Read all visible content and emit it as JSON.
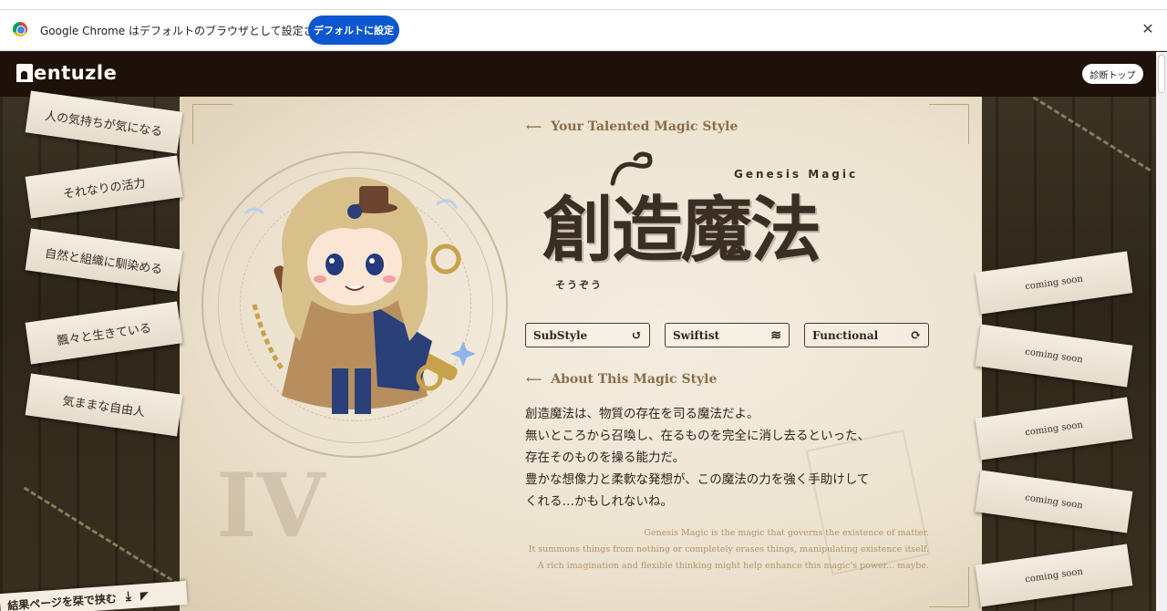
{
  "browser": {
    "infobar": {
      "message": "Google Chrome はデフォルトのブラウザとして設定されていません",
      "button_label": "デフォルトに設定",
      "close_glyph": "✕"
    }
  },
  "header": {
    "logo_text": "entuzle",
    "diagnosis_top_label": "診断トップ"
  },
  "traits": [
    "人の気持ちが気になる",
    "それなりの活力",
    "自然と組織に馴染める",
    "飄々と生きている",
    "気ままな自由人"
  ],
  "coming_soon": [
    "coming soon",
    "coming soon",
    "coming soon",
    "coming soon",
    "coming soon"
  ],
  "result": {
    "section_style_heading": "Your Talented Magic Style",
    "genesis_label": "Genesis Magic",
    "style_title": "創造魔法",
    "style_reading": "そうぞう",
    "tags": [
      {
        "label": "SubStyle",
        "icon": "↺"
      },
      {
        "label": "Swiftist",
        "icon": "≋"
      },
      {
        "label": "Functional",
        "icon": "⟳"
      }
    ],
    "section_about_heading": "About This Magic Style",
    "description_jp": [
      "創造魔法は、物質の存在を司る魔法だよ。",
      "無いところから召喚し、在るものを完全に消し去るといった、",
      "存在そのものを操る能力だ。",
      "豊かな想像力と柔軟な発想が、この魔法の力を強く手助けして",
      "くれる…かもしれないね。"
    ],
    "description_en": [
      "Genesis Magic is the magic that governs the existence of matter.",
      "It summons things from nothing or completely erases things, manipulating existence itself.",
      "A rich imagination and flexible thinking might help enhance this magic's power... maybe."
    ],
    "roman_numeral": "IV"
  },
  "save_bar_label": "結果ページを栞で挟む",
  "colors": {
    "chrome_blue": "#0b57d0",
    "header_bg": "#1e1109",
    "parchment": "#f4ede0",
    "ink": "#3a2e25",
    "accent_brown": "#8a6d48"
  }
}
